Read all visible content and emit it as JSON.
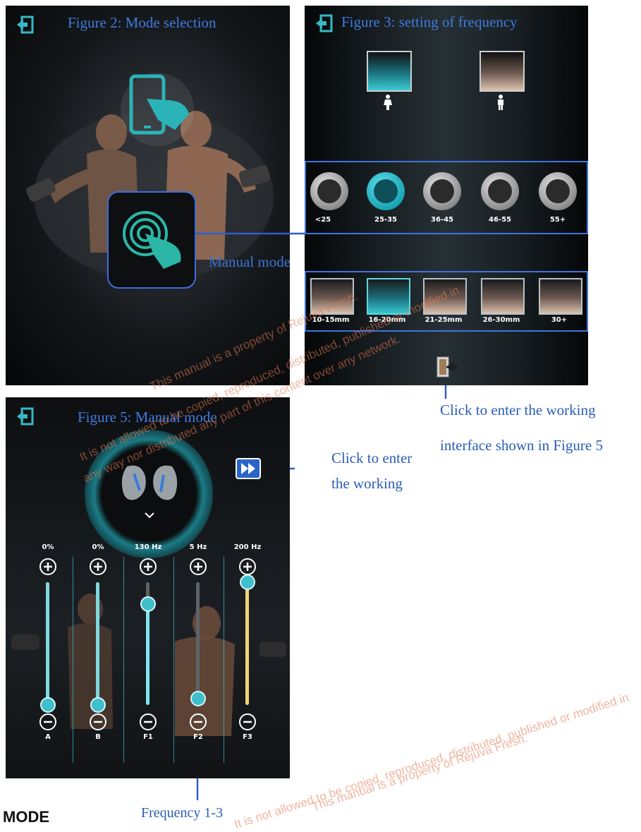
{
  "figure2": {
    "title": "Figure 2: Mode selection",
    "manual_mode_label": "Manual mode"
  },
  "figure3": {
    "title": "Figure 3: setting of frequency",
    "gender_options": [
      {
        "icon": "female-icon",
        "selected": true
      },
      {
        "icon": "male-icon",
        "selected": false
      }
    ],
    "age_options": [
      {
        "label": "<25",
        "selected": false
      },
      {
        "label": "25-35",
        "selected": true
      },
      {
        "label": "36-45",
        "selected": false
      },
      {
        "label": "46-55",
        "selected": false
      },
      {
        "label": "55+",
        "selected": false
      }
    ],
    "size_options": [
      {
        "label": "10-15mm",
        "selected": false
      },
      {
        "label": "16-20mm",
        "selected": true
      },
      {
        "label": "21-25mm",
        "selected": false
      },
      {
        "label": "26-30mm",
        "selected": false
      },
      {
        "label": "30+",
        "selected": false
      }
    ]
  },
  "figure5": {
    "title": "Figure 5: Manual mode",
    "channels": [
      {
        "label": "A",
        "value": "0%",
        "level": 0.0,
        "color": "#7fd9df"
      },
      {
        "label": "B",
        "value": "0%",
        "level": 0.0,
        "color": "#7fd9df"
      },
      {
        "label": "F1",
        "value": "130 Hz",
        "level": 0.82,
        "color": "#7fe6ec"
      },
      {
        "label": "F2",
        "value": "5  Hz",
        "level": 0.05,
        "color": "#cfd6d8"
      },
      {
        "label": "F3",
        "value": "200 Hz",
        "level": 1.0,
        "color": "#f2d27a"
      }
    ]
  },
  "annotations": {
    "enter_interface_line1": "Click to enter the working",
    "enter_interface_line2": "interface shown in Figure 5",
    "enter_working_line1": "Click to enter",
    "enter_working_line2": "the working",
    "frequency_label": "Frequency 1-3"
  },
  "watermark": {
    "line1": "This manual is a property of Rejuva Fresh.",
    "line2": "It is not allowed to be copied, reproduced, distributed, published or modified in",
    "line3": "any way nor distributed any part of this content over any network."
  },
  "section_heading": "MODE"
}
